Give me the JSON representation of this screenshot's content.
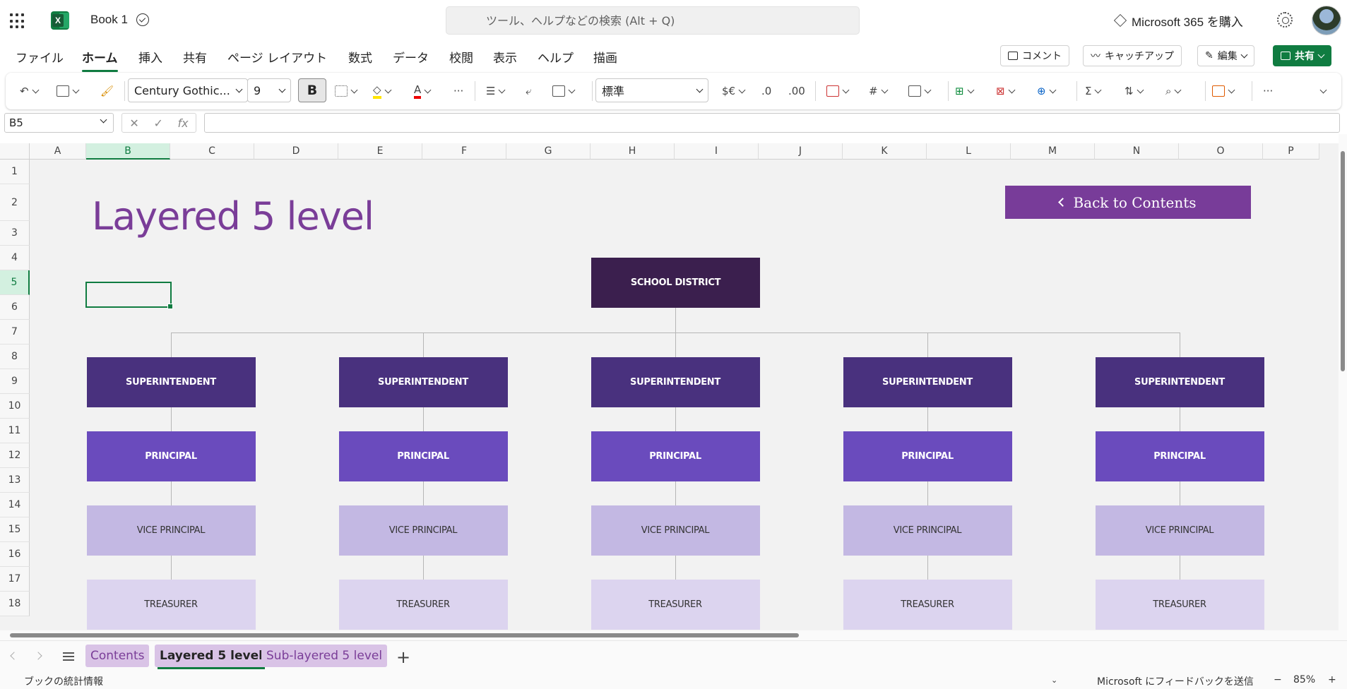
{
  "titlebar": {
    "app_title": "Book 1",
    "search_placeholder": "ツール、ヘルプなどの検索 (Alt + Q)",
    "buy_label": "Microsoft 365 を購入"
  },
  "menu": {
    "tabs": [
      "ファイル",
      "ホーム",
      "挿入",
      "共有",
      "ページ レイアウト",
      "数式",
      "データ",
      "校閲",
      "表示",
      "ヘルプ",
      "描画"
    ],
    "active_tab": "ホーム",
    "comment_label": "コメント",
    "catchup_label": "キャッチアップ",
    "edit_label": "編集",
    "share_label": "共有"
  },
  "ribbon": {
    "font_name": "Century Gothic...",
    "font_size": "9",
    "bold_label": "B",
    "number_format": "標準",
    "currency_label": "$€"
  },
  "formula_bar": {
    "name_box": "B5",
    "formula": ""
  },
  "grid": {
    "columns": [
      "A",
      "B",
      "C",
      "D",
      "E",
      "F",
      "G",
      "H",
      "I",
      "J",
      "K",
      "L",
      "M",
      "N",
      "O",
      "P"
    ],
    "active_column": "B",
    "rows": [
      "1",
      "2",
      "3",
      "4",
      "5",
      "6",
      "7",
      "8",
      "9",
      "10",
      "11",
      "12",
      "13",
      "14",
      "15",
      "16",
      "17",
      "18"
    ],
    "active_row": "5"
  },
  "sheet": {
    "title": "Layered 5 level",
    "back_button": "Back to Contents",
    "root_node": "SCHOOL DISTRICT",
    "level1": "SUPERINTENDENT",
    "level2": "PRINCIPAL",
    "level3": "VICE PRINCIPAL",
    "level4": "TREASURER",
    "branch_count": 5
  },
  "colors": {
    "accent": "#107c41",
    "title_purple": "#7a3d98",
    "root": "#3b1f4e",
    "superintendent": "#49317e",
    "principal": "#6a4bbd",
    "vice_principal": "#c3b8e3",
    "treasurer": "#dcd4ef"
  },
  "sheet_tabs": {
    "tabs": [
      "Contents",
      "Layered 5 level",
      "Sub-layered 5 level"
    ],
    "active": "Layered 5 level"
  },
  "status": {
    "left": "ブックの統計情報",
    "feedback": "Microsoft にフィードバックを送信",
    "zoom": "85%"
  }
}
